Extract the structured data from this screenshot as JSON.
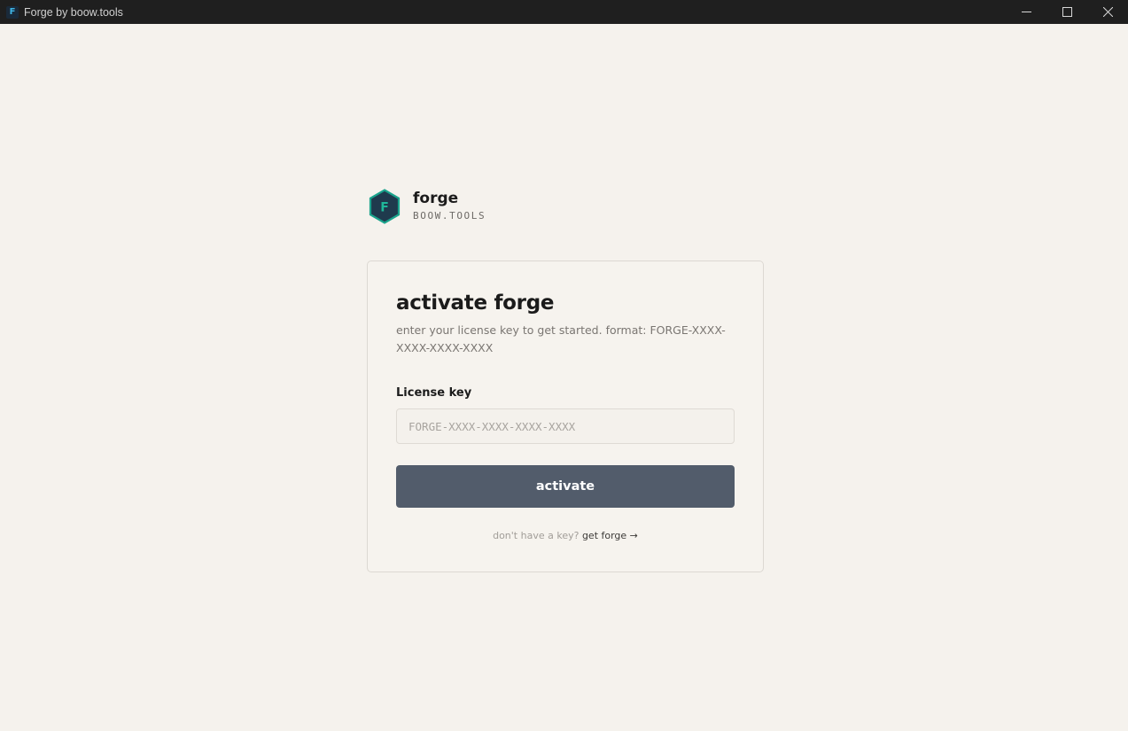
{
  "window": {
    "title": "Forge by boow.tools",
    "icon_letter": "F"
  },
  "brand": {
    "logo_letter": "F",
    "name": "forge",
    "subtitle": "BOOW.TOOLS",
    "colors": {
      "hex_fill": "#1f3a4d",
      "hex_border": "#1aa38c",
      "letter": "#1fb89a"
    }
  },
  "card": {
    "title": "activate forge",
    "description": "enter your license key to get started. format: FORGE-XXXX-XXXX-XXXX-XXXX",
    "field_label": "License key",
    "input": {
      "value": "",
      "placeholder": "FORGE-XXXX-XXXX-XXXX-XXXX"
    },
    "button_label": "activate",
    "footer_prompt": "don't have a key?",
    "footer_link": "get forge →"
  },
  "icons": {
    "minimize": "minimize-icon",
    "maximize": "maximize-icon",
    "close": "close-icon"
  }
}
